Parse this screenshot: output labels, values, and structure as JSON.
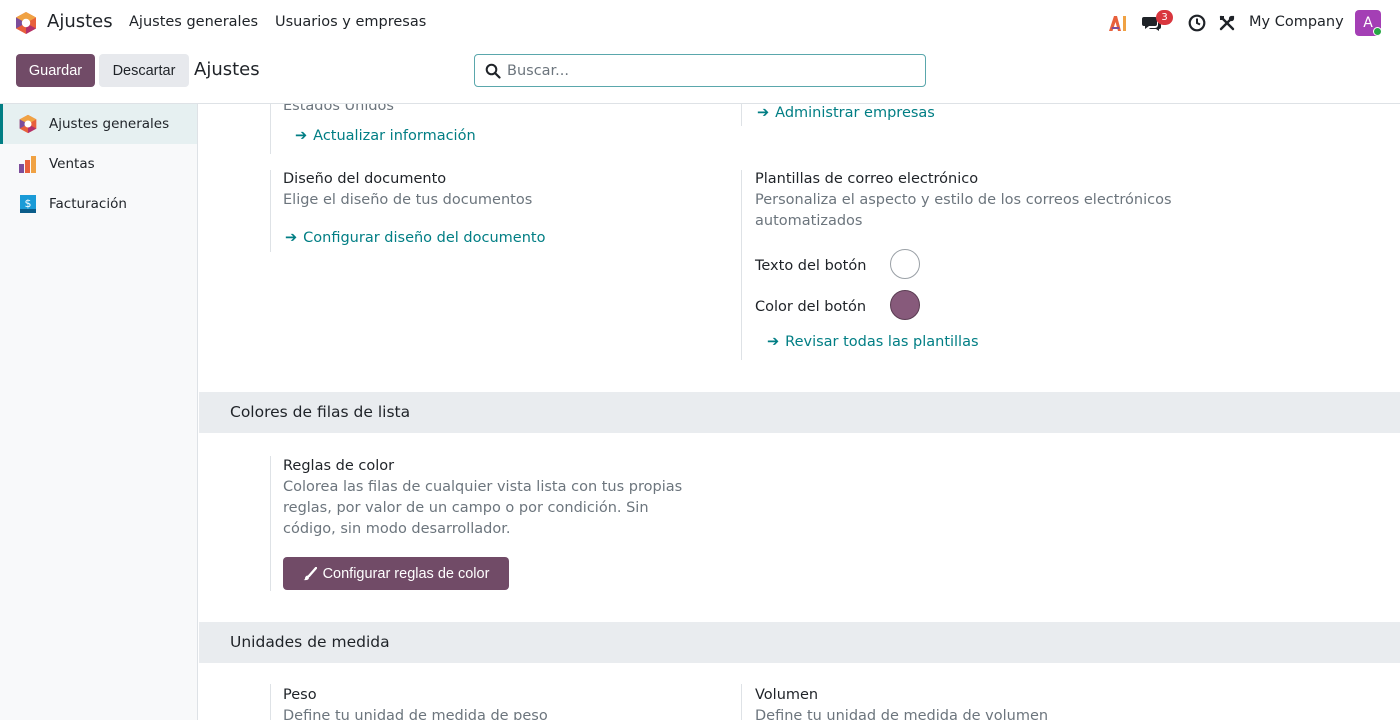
{
  "navbar": {
    "app_name": "Ajustes",
    "menu": [
      "Ajustes generales",
      "Usuarios y empresas"
    ],
    "notification_count": "3",
    "company": "My Company",
    "avatar_initial": "A",
    "icons": [
      "ai-icon",
      "chat-icon",
      "clock-icon",
      "tools-icon"
    ],
    "accent": "#714b67"
  },
  "control_panel": {
    "save_label": "Guardar",
    "discard_label": "Descartar",
    "title": "Ajustes",
    "search_placeholder": "Buscar..."
  },
  "sidebar": {
    "items": [
      {
        "label": "Ajustes generales",
        "icon": "settings-app-icon",
        "active": true
      },
      {
        "label": "Ventas",
        "icon": "sales-app-icon",
        "active": false
      },
      {
        "label": "Facturación",
        "icon": "invoicing-app-icon",
        "active": false
      }
    ]
  },
  "content": {
    "company_partial": {
      "address_tail": "Estados Unidos",
      "update_link": "Actualizar información",
      "manage_link": "Administrar empresas"
    },
    "document_layout": {
      "title": "Diseño del documento",
      "desc": "Elige el diseño de tus documentos",
      "link": "Configurar diseño del documento"
    },
    "email_templates": {
      "title": "Plantillas de correo electrónico",
      "desc_line1": "Personaliza el aspecto y estilo de los correos electrónicos",
      "desc_line2": "automatizados",
      "button_text_label": "Texto del botón",
      "button_text_color": "#ffffff",
      "button_color_label": "Color del botón",
      "button_color": "#875a7b",
      "link": "Revisar todas las plantillas"
    },
    "list_row_colors": {
      "section_title": "Colores de filas de lista",
      "title": "Reglas de color",
      "desc_line1": "Colorea las filas de cualquier vista lista con tus propias",
      "desc_line2": "reglas, por valor de un campo o por condición. Sin",
      "desc_line3": "código, sin modo desarrollador.",
      "button_label": "Configurar reglas de color"
    },
    "units": {
      "section_title": "Unidades de medida",
      "weight_title": "Peso",
      "weight_desc": "Define tu unidad de medida de peso",
      "volume_title": "Volumen",
      "volume_desc": "Define tu unidad de medida de volumen"
    }
  }
}
